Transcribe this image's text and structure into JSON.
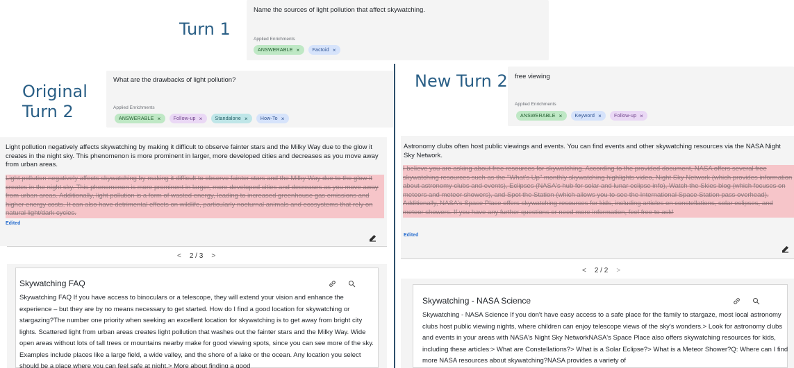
{
  "turn1": {
    "label": "Turn 1",
    "query": "Name the sources of light pollution that affect skywatching.",
    "enrichments_title": "Applied Enrichments",
    "chips": [
      "ANSWERABLE",
      "Factoid"
    ]
  },
  "left": {
    "label_line1": "Original",
    "label_line2": "Turn 2",
    "query": "What are the drawbacks of light pollution?",
    "enrichments_title": "Applied Enrichments",
    "chips": [
      "ANSWERABLE",
      "Follow-up",
      "Standalone",
      "How-To"
    ],
    "answer": "Light pollution negatively affects skywatching by making it difficult to observe fainter stars and the Milky Way due to the glow it creates in the night sky. This phenomenon is more prominent in larger, more developed cities and decreases as you move away from urban areas.",
    "struck": "Light pollution negatively affects skywatching by making it difficult to observe fainter stars and the Milky Way due to the glow it creates in the night sky. This phenomenon is more prominent in larger, more developed cities and decreases as you move away from urban areas. Additionally, light pollution is a form of wasted energy, leading to increased greenhouse gas emissions and higher energy costs. It can also have detrimental effects on wildlife, particularly nocturnal animals and ecosystems that rely on natural light/dark cycles.",
    "edited": "Edited",
    "pager": {
      "prev": "<",
      "text": "2 / 3",
      "next": ">"
    },
    "doc_title": "Skywatching FAQ",
    "doc_body": "Skywatching FAQ If you have access to binoculars or a telescope, they will extend your vision and enhance the experience – but they are by no means necessary to get started. How do I find a good location for skywatching or stargazing?The number one priority when seeking an excellent location for skywatching is to get away from bright city lights. Scattered light from urban areas creates light pollution that washes out the fainter stars and the Milky Way. Wide open areas without lots of tall trees or mountains nearby make for good viewing spots, since you can see more of the sky. Examples include places like a large field, a wide valley, and the shore of a lake or the ocean. Any location you select should be a place where you can feel safe at night.> More about finding a good"
  },
  "right": {
    "label": "New Turn 2",
    "query": "free viewing",
    "enrichments_title": "Applied Enrichments",
    "chips": [
      "ANSWERABLE",
      "Keyword",
      "Follow-up"
    ],
    "answer": "Astronomy clubs often host public viewings and events. You can find events and other skywatching resources via the NASA Night Sky Network.",
    "struck": "I believe you are asking about free resources for skywatching. According to the provided document, NASA offers several free skywatching resources such as the \"What's Up\" monthly skywatching highlights video, Night Sky Network (which provides information about astronomy clubs and events), Eclipses (NASA's hub for solar and lunar eclipse info), Watch the Skies blog (which focuses on meteors and meteor showers), and Spot the Station (which allows you to see the International Space Station pass overhead). Additionally, NASA's Space Place offers skywatching resources for kids, including articles on constellations, solar eclipses, and meteor showers. If you have any further questions or need more information, feel free to ask!",
    "edited": "Edited",
    "pager": {
      "prev": "<",
      "text": "2 / 2",
      "next": ">"
    },
    "doc_title": "Skywatching - NASA Science",
    "doc_body": "Skywatching - NASA Science If you don't have easy access to a safe place for the family to stargaze, most local astronomy clubs host public viewing nights, where children can enjoy telescope views of the sky's wonders.> Look for astronomy clubs and events in your areas with NASA's Night Sky NetworkNASA's Space Place also offers skywatching resources for kids, including these articles:> What are Constellations?> What is a Solar Eclipse?> What is a Meteor Shower?Q: Where can I find more NASA resources about skywatching?NASA provides a variety of"
  }
}
